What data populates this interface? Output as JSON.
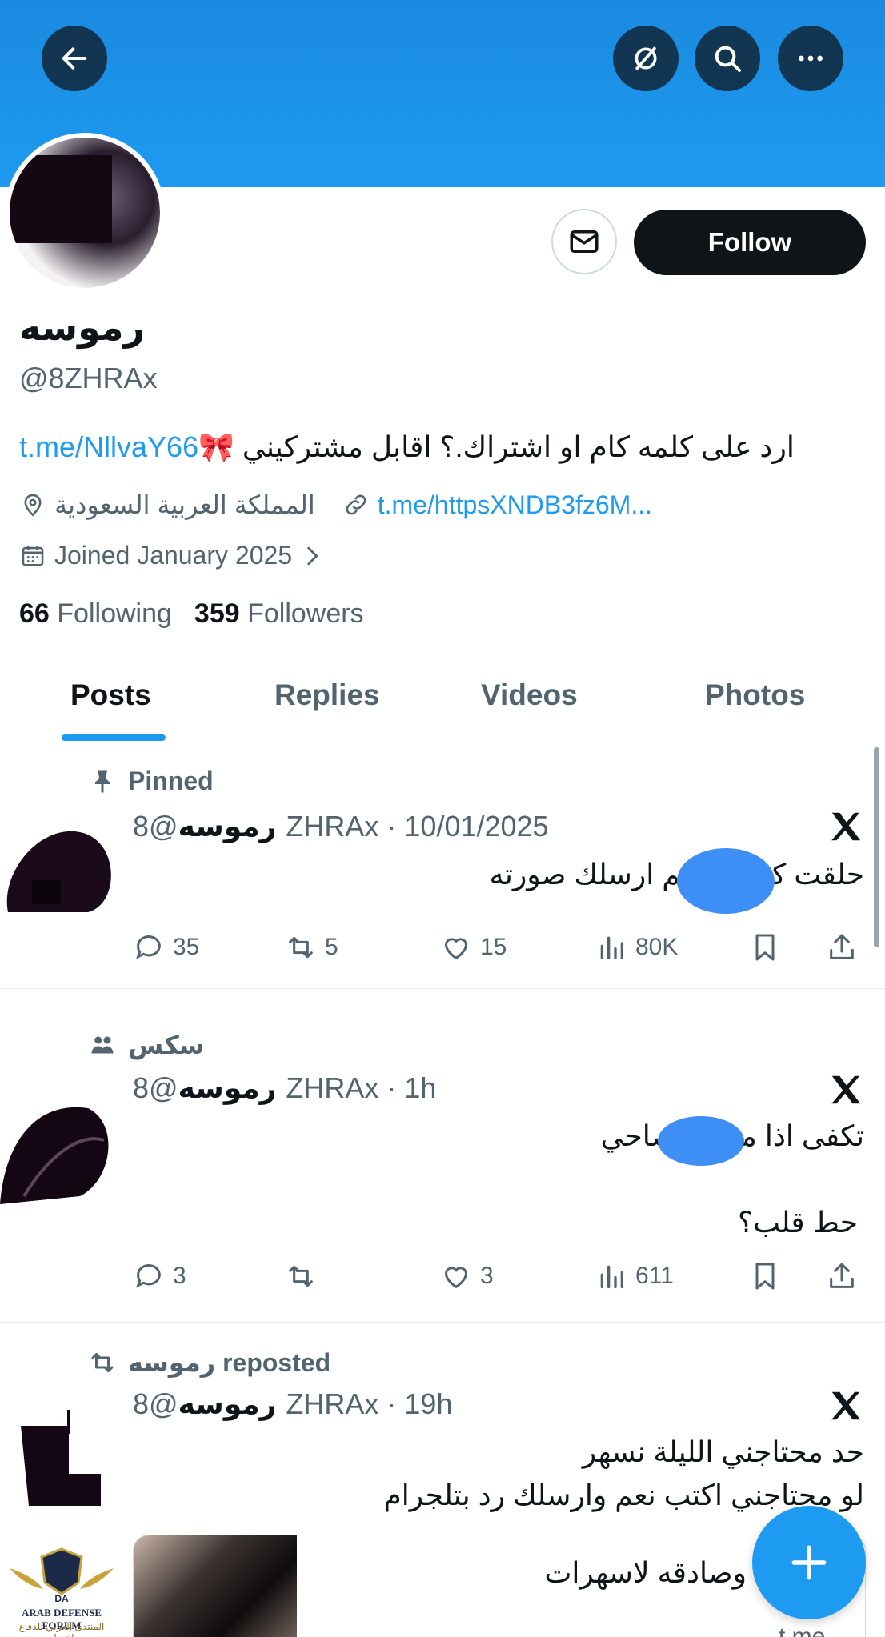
{
  "header": {
    "back_icon": "arrow-left-icon",
    "grok_icon": "slash-circle-icon",
    "search_icon": "search-icon",
    "more_icon": "more-horizontal-icon"
  },
  "profile": {
    "display_name": "رموسه",
    "handle": "@8ZHRAx",
    "follow_label": "Follow",
    "bio_text": "ارد على كلمه كام او اشتراك.؟ اقابل مشتركيني ",
    "bio_emoji": "🎀",
    "bio_link": "t.me/NllvaY66",
    "location": "المملكة العربية السعودية",
    "website": "t.me/httpsXNDB3fz6M...",
    "joined": "Joined January 2025",
    "following_count": "66",
    "following_label": "Following",
    "followers_count": "359",
    "followers_label": "Followers"
  },
  "tabs": [
    {
      "label": "Posts",
      "active": true
    },
    {
      "label": "Replies",
      "active": false
    },
    {
      "label": "Videos",
      "active": false
    },
    {
      "label": "Photos",
      "active": false
    }
  ],
  "posts": [
    {
      "context": "Pinned",
      "name": "رموسه",
      "meta": "@8ZHRAx · 10/01/2025",
      "lines": [
        "حلقت كـ        اكتب تم ارسلك صورته"
      ],
      "replies": "35",
      "reposts": "5",
      "likes": "15",
      "views": "80K"
    },
    {
      "context": "سكس",
      "name": "رموسه",
      "meta": "@8ZHRAx · 1h",
      "lines": [
        "تكفى اذا مـ        ـيك صاحي",
        "حط قلب؟"
      ],
      "replies": "3",
      "reposts": "",
      "likes": "3",
      "views": "611"
    },
    {
      "context": "رموسه reposted",
      "name": "رموسه",
      "meta": "@8ZHRAx · 19h",
      "lines": [
        "حد محتاجني الليلة نسهر",
        "لو محتاجني اكتب نعم وارسلك رد بتلجرام"
      ],
      "card_text": "…ساده وصادقه لاسهرات",
      "card_sub": "t.me"
    }
  ],
  "watermark": {
    "title": "ARAB DEFENSE FORUM",
    "subtitle": "المنتدى العربي للدفاع والتسليح"
  },
  "colors": {
    "banner": "#1d9bf0",
    "accent": "#1d9bf0",
    "text": "#0f1419",
    "muted": "#536471",
    "redaction": "#3d8ef5"
  }
}
